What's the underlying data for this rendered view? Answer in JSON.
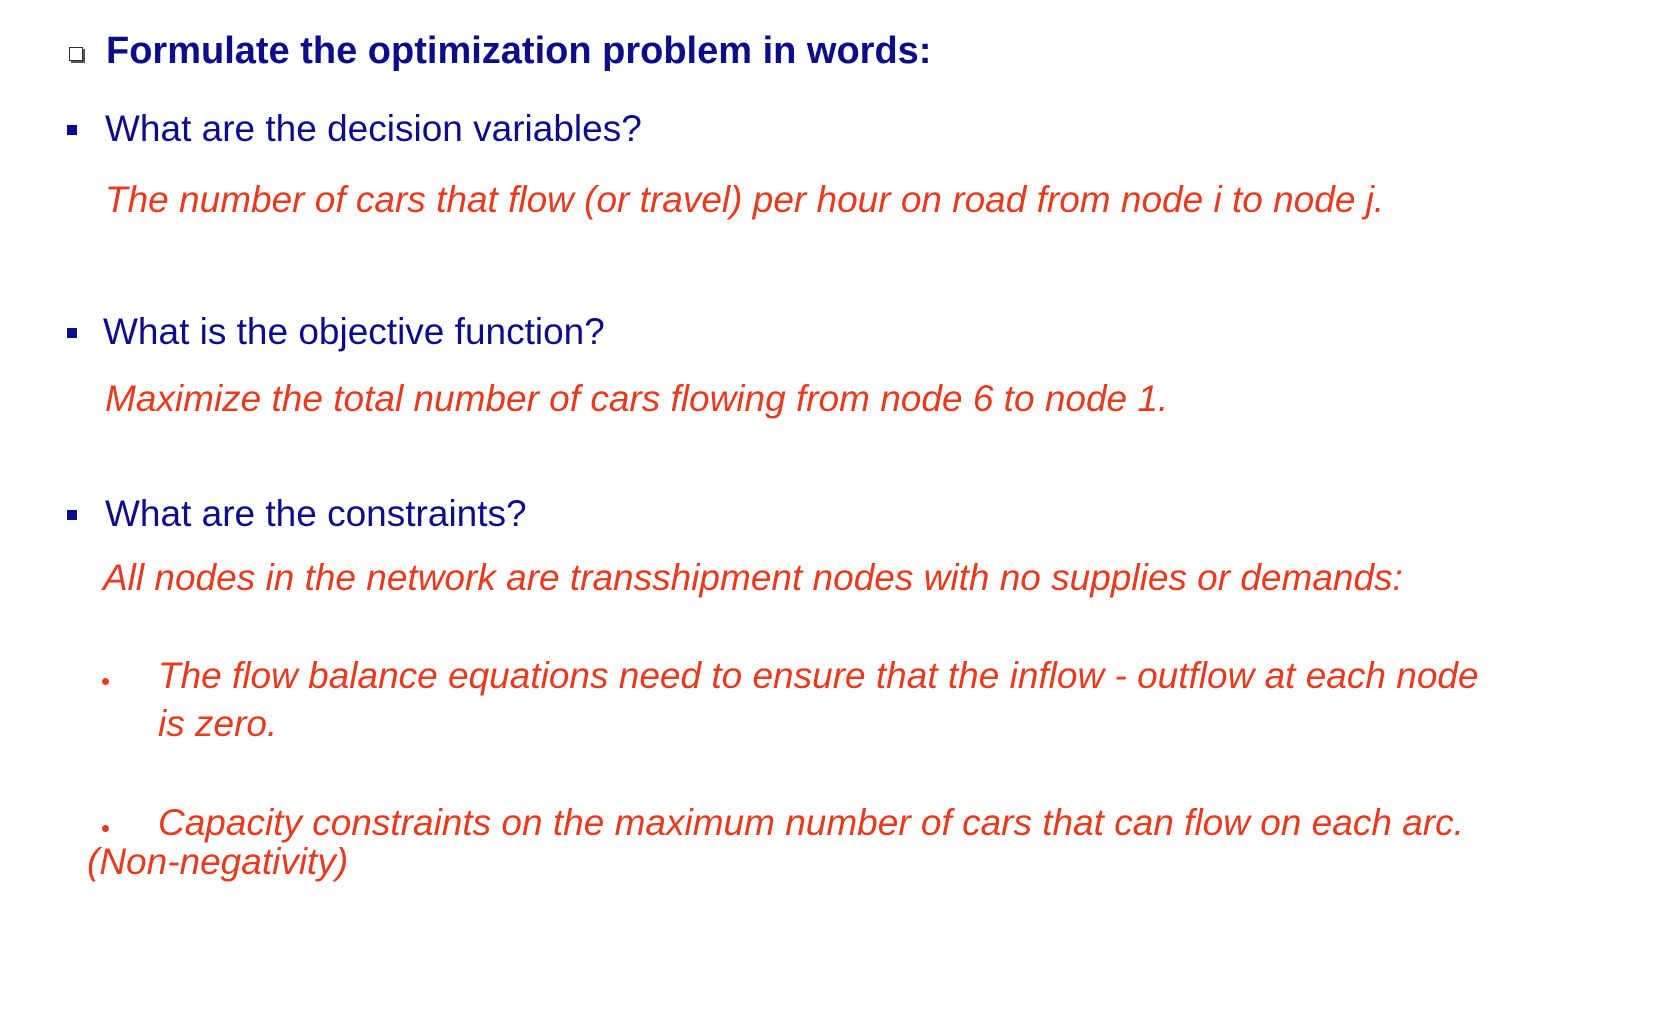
{
  "heading": {
    "icon": "hollow-square-bullet",
    "text": "Formulate the optimization problem in words:"
  },
  "sections": [
    {
      "question": "What are the decision variables?",
      "answer": "The number of cars that flow (or travel) per hour on road from node i to node j."
    },
    {
      "question": "What is the objective function?",
      "answer": "Maximize the total number of cars flowing from node 6 to node 1."
    },
    {
      "question": "What are the constraints?",
      "answer": "All nodes in the network are transshipment nodes with no supplies or demands:"
    }
  ],
  "constraints": [
    {
      "line1": "The flow balance equations need to ensure that the inflow - outflow at each node",
      "line2": "is zero."
    },
    {
      "line1": "Capacity constraints on the maximum number of cars that can flow on each arc.",
      "line2": "(Non-negativity)"
    }
  ],
  "colors": {
    "heading": "#0d0d8c",
    "question": "#0d0d8c",
    "answer": "#ea3a1e"
  }
}
